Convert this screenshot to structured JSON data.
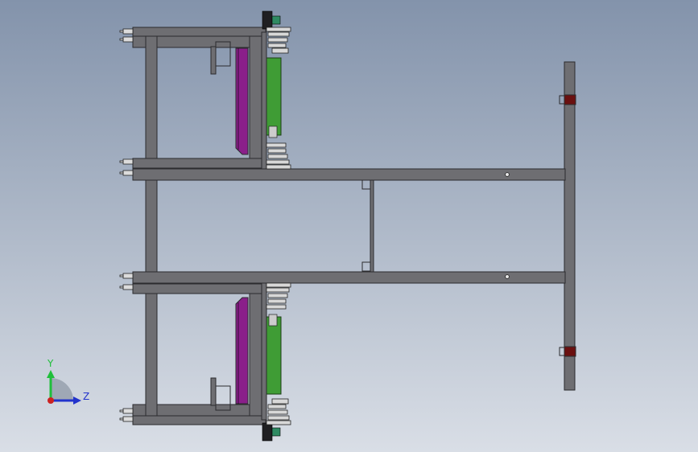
{
  "triad": {
    "y_label": "Y",
    "z_label": "Z",
    "y_color": "#1fbf3a",
    "z_color": "#2233cc",
    "x_color": "#cc2222",
    "arc_color": "#9aa3b0"
  },
  "colors": {
    "frame": "#6e6e72",
    "frame_edge": "#2b2b2e",
    "plate": "#7a7a7e",
    "pcb": "#3f9c35",
    "magenta": "#8a1f8a",
    "red_block": "#6a1010",
    "dark": "#1f1f22",
    "teal": "#2e8a62"
  }
}
